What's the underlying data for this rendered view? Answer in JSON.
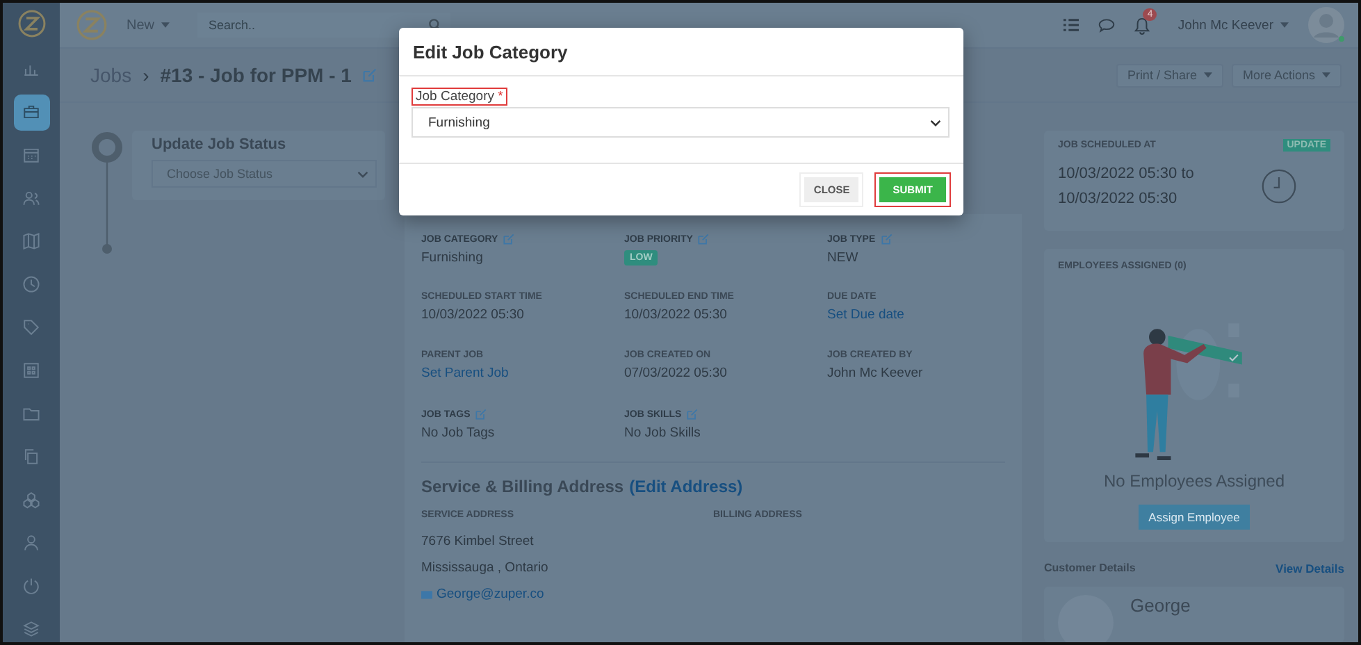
{
  "sidebar": {
    "items": [
      {
        "selected": false
      },
      {
        "selected": true
      },
      {
        "selected": false
      },
      {
        "selected": false
      },
      {
        "selected": false
      },
      {
        "selected": false
      },
      {
        "selected": false
      },
      {
        "selected": false
      },
      {
        "selected": false
      },
      {
        "selected": false
      },
      {
        "selected": false
      },
      {
        "selected": false
      },
      {
        "selected": false
      },
      {
        "selected": false
      }
    ]
  },
  "top_bar": {
    "new_button": "New",
    "search": {
      "placeholder": "Search.."
    },
    "notification_count": "4",
    "user_name": "John Mc Keever",
    "user_online": true
  },
  "breadcrumb": {
    "parent": "Jobs",
    "separator": "›",
    "title": "#13 - Job for PPM - 1"
  },
  "header_buttons": [
    "Print / Share",
    "More Actions"
  ],
  "status_panel": {
    "title": "Update Job Status",
    "placeholder": "Choose Job Status"
  },
  "job_fields": [
    {
      "label": "JOB CATEGORY",
      "value": "Furnishing",
      "editable": true,
      "kind": "text"
    },
    {
      "label": "JOB PRIORITY",
      "value": "LOW",
      "editable": true,
      "kind": "badge"
    },
    {
      "label": "JOB TYPE",
      "value": "NEW",
      "editable": true,
      "kind": "text"
    },
    {
      "label": "SCHEDULED START TIME",
      "value": "10/03/2022 05:30",
      "editable": false,
      "kind": "text"
    },
    {
      "label": "SCHEDULED END TIME",
      "value": "10/03/2022 05:30",
      "editable": false,
      "kind": "text"
    },
    {
      "label": "DUE DATE",
      "value": "Set Due date",
      "editable": false,
      "kind": "link"
    },
    {
      "label": "PARENT JOB",
      "value": "Set Parent Job",
      "editable": false,
      "kind": "link"
    },
    {
      "label": "JOB CREATED ON",
      "value": "07/03/2022 05:30",
      "editable": false,
      "kind": "text"
    },
    {
      "label": "JOB CREATED BY",
      "value": "John Mc Keever",
      "editable": false,
      "kind": "text"
    },
    {
      "label": "JOB TAGS",
      "value": "No Job Tags",
      "editable": true,
      "kind": "text"
    },
    {
      "label": "JOB SKILLS",
      "value": "No Job Skills",
      "editable": true,
      "kind": "text"
    }
  ],
  "address": {
    "title": "Service & Billing Address",
    "edit_link": "(Edit Address)",
    "service_label": "SERVICE ADDRESS",
    "billing_label": "BILLING ADDRESS",
    "lines": [
      "7676 Kimbel Street",
      "Mississauga , Ontario"
    ],
    "email": "George@zuper.co"
  },
  "schedule": {
    "title": "JOB SCHEDULED AT",
    "badge": "UPDATE",
    "from": "10/03/2022 05:30 to",
    "to": "10/03/2022 05:30"
  },
  "employees": {
    "title": "EMPLOYEES ASSIGNED (0)",
    "empty_text": "No Employees Assigned",
    "button": "Assign Employee"
  },
  "customer": {
    "title": "Customer Details",
    "link": "View Details",
    "name": "George"
  },
  "modal": {
    "title": "Edit Job Category",
    "field_label": "Job Category",
    "required_mark": "*",
    "label_highlighted": true,
    "value": "Furnishing",
    "buttons": [
      {
        "label": "CLOSE",
        "kind": "secondary",
        "highlighted": false
      },
      {
        "label": "SUBMIT",
        "kind": "primary",
        "highlighted": true
      }
    ]
  }
}
